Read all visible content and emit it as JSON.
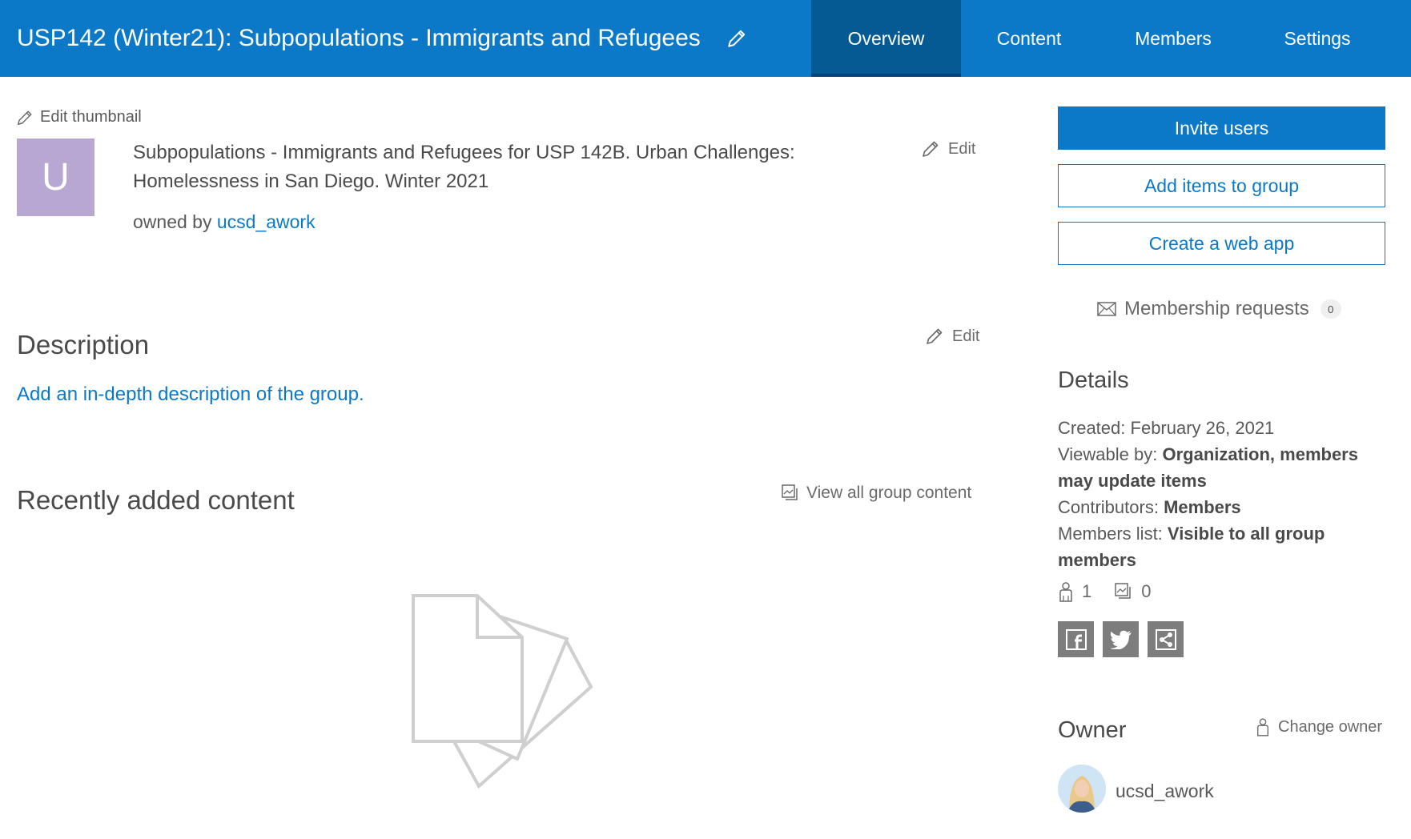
{
  "header": {
    "title": "USP142 (Winter21): Subpopulations - Immigrants and Refugees",
    "tabs": [
      {
        "label": "Overview",
        "active": true
      },
      {
        "label": "Content",
        "active": false
      },
      {
        "label": "Members",
        "active": false
      },
      {
        "label": "Settings",
        "active": false
      }
    ],
    "colors": {
      "bar": "#0b79c7",
      "active_tab": "#065a94"
    }
  },
  "thumbnail": {
    "edit_label": "Edit thumbnail",
    "letter": "U",
    "color": "#b8a6d3"
  },
  "summary": {
    "text": "Subpopulations - Immigrants and Refugees for USP 142B. Urban Challenges: Homelessness in San Diego. Winter 2021",
    "edit_label": "Edit",
    "owned_prefix": "owned by",
    "owner": "ucsd_awork"
  },
  "description": {
    "title": "Description",
    "edit_label": "Edit",
    "placeholder_link": "Add an in-depth description of the group."
  },
  "recent": {
    "title": "Recently added content",
    "view_all_label": "View all group content",
    "empty_icon": "empty-documents-icon"
  },
  "actions": {
    "invite": "Invite users",
    "add_items": "Add items to group",
    "create_app": "Create a web app",
    "membership_requests_label": "Membership requests",
    "membership_requests_count": "0"
  },
  "details": {
    "title": "Details",
    "created_label": "Created:",
    "created_value": "February 26, 2021",
    "viewable_label": "Viewable by:",
    "viewable_value": "Organization, members may update items",
    "contributors_label": "Contributors:",
    "contributors_value": "Members",
    "members_list_label": "Members list:",
    "members_list_value": "Visible to all group members",
    "member_count": "1",
    "item_count": "0"
  },
  "share": {
    "icons": [
      "facebook-icon",
      "twitter-icon",
      "share-icon"
    ]
  },
  "owner": {
    "title": "Owner",
    "change_label": "Change owner",
    "username": "ucsd_awork"
  }
}
